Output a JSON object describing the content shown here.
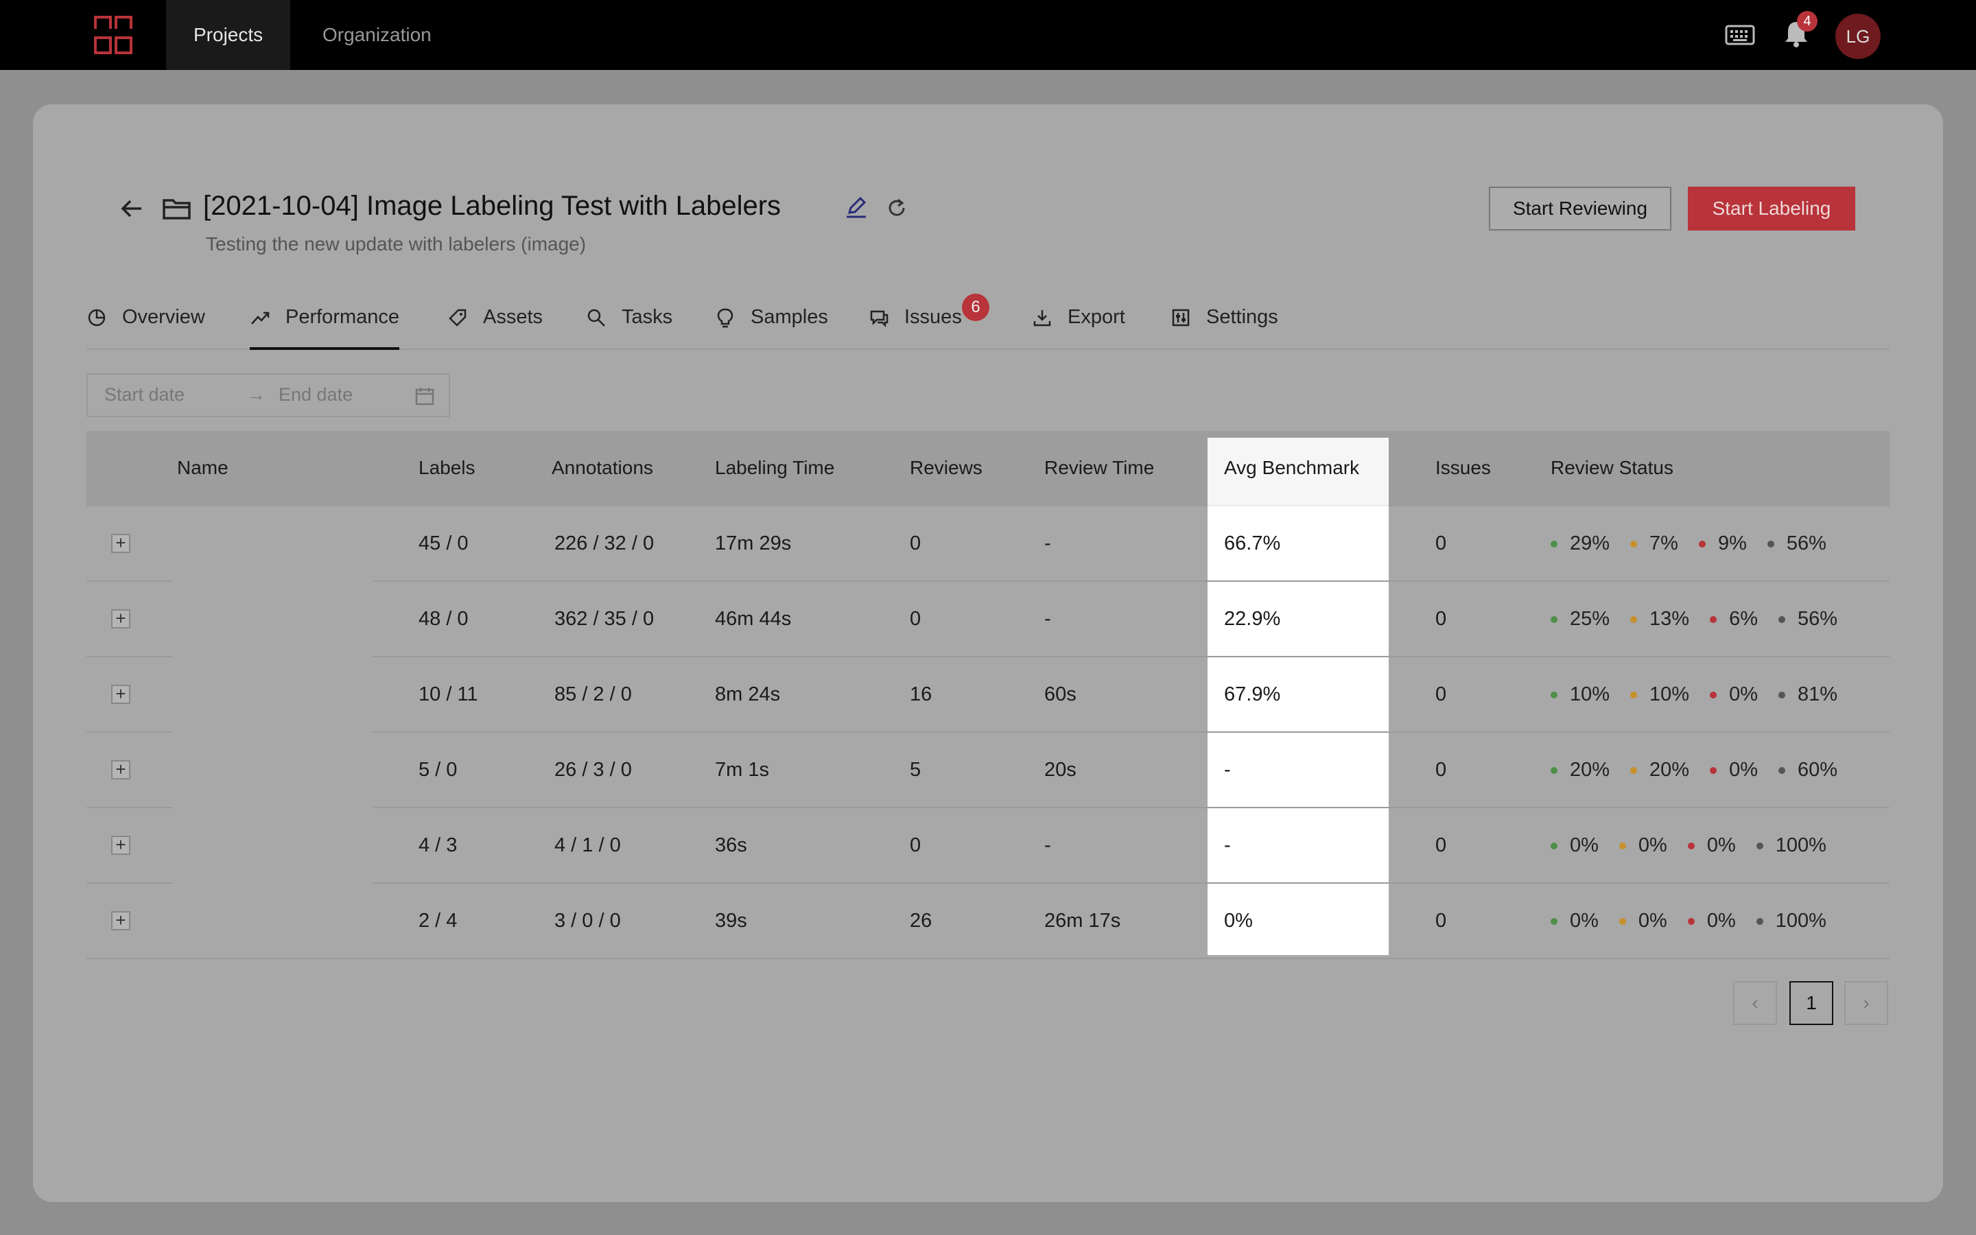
{
  "topbar": {
    "nav": [
      "Projects",
      "Organization"
    ],
    "notification_count": "4",
    "avatar_initials": "LG",
    "brand_color": "#b8333a"
  },
  "project": {
    "title": "[2021-10-04] Image Labeling Test with Labelers",
    "subtitle": "Testing the new update with labelers (image)",
    "start_reviewing": "Start Reviewing",
    "start_labeling": "Start Labeling"
  },
  "tabs": [
    {
      "label": "Overview",
      "icon": "pie-chart-icon"
    },
    {
      "label": "Performance",
      "icon": "trend-icon"
    },
    {
      "label": "Assets",
      "icon": "tag-icon"
    },
    {
      "label": "Tasks",
      "icon": "search-icon"
    },
    {
      "label": "Samples",
      "icon": "bulb-icon"
    },
    {
      "label": "Issues",
      "icon": "chat-icon"
    },
    {
      "label": "Export",
      "icon": "download-icon"
    },
    {
      "label": "Settings",
      "icon": "sliders-icon"
    }
  ],
  "issues_badge": "6",
  "daterange": {
    "start_placeholder": "Start date",
    "arrow": "→",
    "end_placeholder": "End date"
  },
  "table": {
    "headers": [
      "Name",
      "Labels",
      "Annotations",
      "Labeling Time",
      "Reviews",
      "Review Time",
      "Avg Benchmark",
      "Issues",
      "Review Status"
    ],
    "rows": [
      {
        "labels": "45 / 0",
        "annotations": "226 / 32 / 0",
        "labeling_time": "17m 29s",
        "reviews": "0",
        "review_time": "-",
        "avg_benchmark": "66.7%",
        "issues": "0",
        "status": [
          "29%",
          "7%",
          "9%",
          "56%"
        ]
      },
      {
        "labels": "48 / 0",
        "annotations": "362 / 35 / 0",
        "labeling_time": "46m 44s",
        "reviews": "0",
        "review_time": "-",
        "avg_benchmark": "22.9%",
        "issues": "0",
        "status": [
          "25%",
          "13%",
          "6%",
          "56%"
        ]
      },
      {
        "labels": "10 / 11",
        "annotations": "85 / 2 / 0",
        "labeling_time": "8m 24s",
        "reviews": "16",
        "review_time": "60s",
        "avg_benchmark": "67.9%",
        "issues": "0",
        "status": [
          "10%",
          "10%",
          "0%",
          "81%"
        ]
      },
      {
        "labels": "5 / 0",
        "annotations": "26 / 3 / 0",
        "labeling_time": "7m 1s",
        "reviews": "5",
        "review_time": "20s",
        "avg_benchmark": "-",
        "issues": "0",
        "status": [
          "20%",
          "20%",
          "0%",
          "60%"
        ]
      },
      {
        "labels": "4 / 3",
        "annotations": "4 / 1 / 0",
        "labeling_time": "36s",
        "reviews": "0",
        "review_time": "-",
        "avg_benchmark": "-",
        "issues": "0",
        "status": [
          "0%",
          "0%",
          "0%",
          "100%"
        ]
      },
      {
        "labels": "2 / 4",
        "annotations": "3 / 0 / 0",
        "labeling_time": "39s",
        "reviews": "26",
        "review_time": "26m 17s",
        "avg_benchmark": "0%",
        "issues": "0",
        "status": [
          "0%",
          "0%",
          "0%",
          "100%"
        ]
      }
    ],
    "status_colors": [
      "#4e8f4a",
      "#c8902c",
      "#b8333a",
      "#555555"
    ]
  },
  "pagination": {
    "prev": "‹",
    "current": "1",
    "next": "›"
  }
}
